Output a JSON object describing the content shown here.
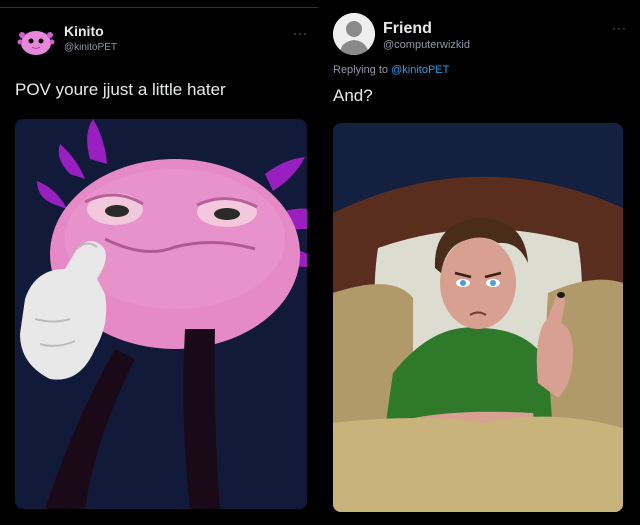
{
  "tweet_left": {
    "author_name": "Kinito",
    "author_handle": "@kinitoPET",
    "more_label": "···",
    "text": "POV youre jjust a little hater",
    "avatar_icon": "pink-axolotl-avatar",
    "media_description_icon": "axolotl-illustration"
  },
  "tweet_right": {
    "author_name": "Friend",
    "author_handle": "@computerwizkid",
    "more_label": "···",
    "replying_prefix": "Replying to",
    "replying_mention": "@kinitoPET",
    "text": "And?",
    "avatar_icon": "default-profile-avatar",
    "media_description_icon": "man-in-bed-illustration"
  },
  "colors": {
    "background": "#000000",
    "text_primary": "#e7e9ea",
    "text_secondary": "#8b98a5",
    "mention": "#1d9bf0",
    "axolotl_pink": "#e48cc8",
    "gill_purple": "#a020c8"
  }
}
